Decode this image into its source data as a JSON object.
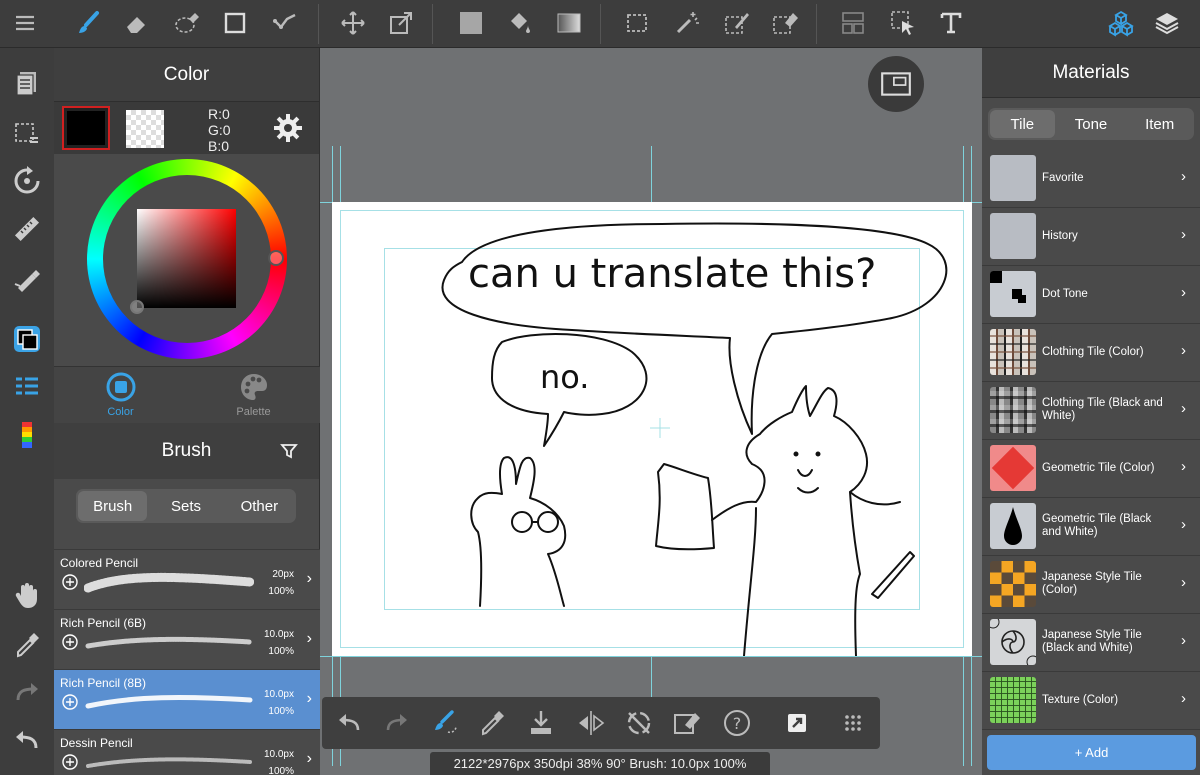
{
  "colors": {
    "accent": "#39a3e6",
    "selected_brush": "#5a8fd0",
    "add_button": "#5b9be0"
  },
  "color_panel": {
    "title": "Color",
    "r": "R:0",
    "g": "G:0",
    "b": "B:0",
    "tabs": [
      {
        "label": "Color",
        "icon": "color-square-icon",
        "active": true
      },
      {
        "label": "Palette",
        "icon": "palette-icon",
        "active": false
      }
    ]
  },
  "brush_panel": {
    "title": "Brush",
    "segments": [
      "Brush",
      "Sets",
      "Other"
    ],
    "active_segment": "Brush",
    "items": [
      {
        "name": "Colored Pencil",
        "size": "20px",
        "opacity": "100%",
        "selected": false
      },
      {
        "name": "Rich Pencil (6B)",
        "size": "10.0px",
        "opacity": "100%",
        "selected": false
      },
      {
        "name": "Rich Pencil (8B)",
        "size": "10.0px",
        "opacity": "100%",
        "selected": true
      },
      {
        "name": "Dessin Pencil",
        "size": "10.0px",
        "opacity": "100%",
        "selected": false
      }
    ]
  },
  "canvas": {
    "speech_big": "can u translate this?",
    "speech_small": "no."
  },
  "status": "2122*2976px 350dpi 38% 90° Brush: 10.0px 100%",
  "materials": {
    "title": "Materials",
    "segments": [
      "Tile",
      "Tone",
      "Item"
    ],
    "active_segment": "Tile",
    "items": [
      {
        "label": "Favorite",
        "thumb": "plain"
      },
      {
        "label": "History",
        "thumb": "plain"
      },
      {
        "label": "Dot Tone",
        "thumb": "dots"
      },
      {
        "label": "Clothing Tile (Color)",
        "thumb": "plaid-color"
      },
      {
        "label": "Clothing Tile (Black and White)",
        "thumb": "plaid-bw"
      },
      {
        "label": "Geometric Tile (Color)",
        "thumb": "diamond"
      },
      {
        "label": "Geometric Tile (Black and White)",
        "thumb": "drop"
      },
      {
        "label": "Japanese Style Tile (Color)",
        "thumb": "japanese-color"
      },
      {
        "label": "Japanese Style Tile (Black and White)",
        "thumb": "japanese-bw"
      },
      {
        "label": "Texture (Color)",
        "thumb": "texture-green"
      }
    ],
    "add_label": "+ Add"
  }
}
